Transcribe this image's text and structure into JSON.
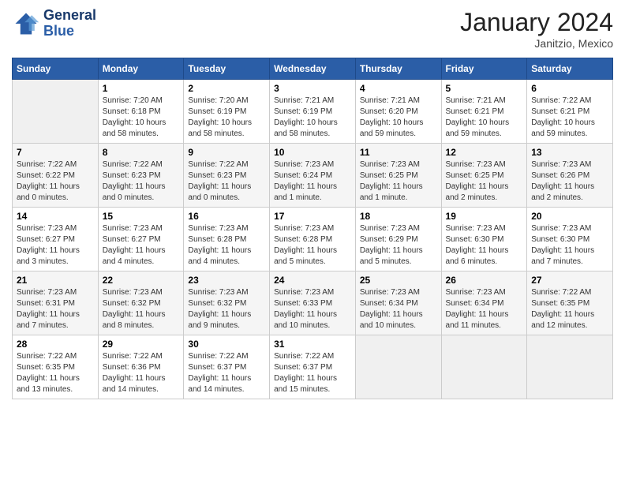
{
  "header": {
    "logo_line1": "General",
    "logo_line2": "Blue",
    "month": "January 2024",
    "location": "Janitzio, Mexico"
  },
  "weekdays": [
    "Sunday",
    "Monday",
    "Tuesday",
    "Wednesday",
    "Thursday",
    "Friday",
    "Saturday"
  ],
  "weeks": [
    [
      {
        "day": "",
        "info": ""
      },
      {
        "day": "1",
        "info": "Sunrise: 7:20 AM\nSunset: 6:18 PM\nDaylight: 10 hours\nand 58 minutes."
      },
      {
        "day": "2",
        "info": "Sunrise: 7:20 AM\nSunset: 6:19 PM\nDaylight: 10 hours\nand 58 minutes."
      },
      {
        "day": "3",
        "info": "Sunrise: 7:21 AM\nSunset: 6:19 PM\nDaylight: 10 hours\nand 58 minutes."
      },
      {
        "day": "4",
        "info": "Sunrise: 7:21 AM\nSunset: 6:20 PM\nDaylight: 10 hours\nand 59 minutes."
      },
      {
        "day": "5",
        "info": "Sunrise: 7:21 AM\nSunset: 6:21 PM\nDaylight: 10 hours\nand 59 minutes."
      },
      {
        "day": "6",
        "info": "Sunrise: 7:22 AM\nSunset: 6:21 PM\nDaylight: 10 hours\nand 59 minutes."
      }
    ],
    [
      {
        "day": "7",
        "info": "Sunrise: 7:22 AM\nSunset: 6:22 PM\nDaylight: 11 hours\nand 0 minutes."
      },
      {
        "day": "8",
        "info": "Sunrise: 7:22 AM\nSunset: 6:23 PM\nDaylight: 11 hours\nand 0 minutes."
      },
      {
        "day": "9",
        "info": "Sunrise: 7:22 AM\nSunset: 6:23 PM\nDaylight: 11 hours\nand 0 minutes."
      },
      {
        "day": "10",
        "info": "Sunrise: 7:23 AM\nSunset: 6:24 PM\nDaylight: 11 hours\nand 1 minute."
      },
      {
        "day": "11",
        "info": "Sunrise: 7:23 AM\nSunset: 6:25 PM\nDaylight: 11 hours\nand 1 minute."
      },
      {
        "day": "12",
        "info": "Sunrise: 7:23 AM\nSunset: 6:25 PM\nDaylight: 11 hours\nand 2 minutes."
      },
      {
        "day": "13",
        "info": "Sunrise: 7:23 AM\nSunset: 6:26 PM\nDaylight: 11 hours\nand 2 minutes."
      }
    ],
    [
      {
        "day": "14",
        "info": "Sunrise: 7:23 AM\nSunset: 6:27 PM\nDaylight: 11 hours\nand 3 minutes."
      },
      {
        "day": "15",
        "info": "Sunrise: 7:23 AM\nSunset: 6:27 PM\nDaylight: 11 hours\nand 4 minutes."
      },
      {
        "day": "16",
        "info": "Sunrise: 7:23 AM\nSunset: 6:28 PM\nDaylight: 11 hours\nand 4 minutes."
      },
      {
        "day": "17",
        "info": "Sunrise: 7:23 AM\nSunset: 6:28 PM\nDaylight: 11 hours\nand 5 minutes."
      },
      {
        "day": "18",
        "info": "Sunrise: 7:23 AM\nSunset: 6:29 PM\nDaylight: 11 hours\nand 5 minutes."
      },
      {
        "day": "19",
        "info": "Sunrise: 7:23 AM\nSunset: 6:30 PM\nDaylight: 11 hours\nand 6 minutes."
      },
      {
        "day": "20",
        "info": "Sunrise: 7:23 AM\nSunset: 6:30 PM\nDaylight: 11 hours\nand 7 minutes."
      }
    ],
    [
      {
        "day": "21",
        "info": "Sunrise: 7:23 AM\nSunset: 6:31 PM\nDaylight: 11 hours\nand 7 minutes."
      },
      {
        "day": "22",
        "info": "Sunrise: 7:23 AM\nSunset: 6:32 PM\nDaylight: 11 hours\nand 8 minutes."
      },
      {
        "day": "23",
        "info": "Sunrise: 7:23 AM\nSunset: 6:32 PM\nDaylight: 11 hours\nand 9 minutes."
      },
      {
        "day": "24",
        "info": "Sunrise: 7:23 AM\nSunset: 6:33 PM\nDaylight: 11 hours\nand 10 minutes."
      },
      {
        "day": "25",
        "info": "Sunrise: 7:23 AM\nSunset: 6:34 PM\nDaylight: 11 hours\nand 10 minutes."
      },
      {
        "day": "26",
        "info": "Sunrise: 7:23 AM\nSunset: 6:34 PM\nDaylight: 11 hours\nand 11 minutes."
      },
      {
        "day": "27",
        "info": "Sunrise: 7:22 AM\nSunset: 6:35 PM\nDaylight: 11 hours\nand 12 minutes."
      }
    ],
    [
      {
        "day": "28",
        "info": "Sunrise: 7:22 AM\nSunset: 6:35 PM\nDaylight: 11 hours\nand 13 minutes."
      },
      {
        "day": "29",
        "info": "Sunrise: 7:22 AM\nSunset: 6:36 PM\nDaylight: 11 hours\nand 14 minutes."
      },
      {
        "day": "30",
        "info": "Sunrise: 7:22 AM\nSunset: 6:37 PM\nDaylight: 11 hours\nand 14 minutes."
      },
      {
        "day": "31",
        "info": "Sunrise: 7:22 AM\nSunset: 6:37 PM\nDaylight: 11 hours\nand 15 minutes."
      },
      {
        "day": "",
        "info": ""
      },
      {
        "day": "",
        "info": ""
      },
      {
        "day": "",
        "info": ""
      }
    ]
  ]
}
